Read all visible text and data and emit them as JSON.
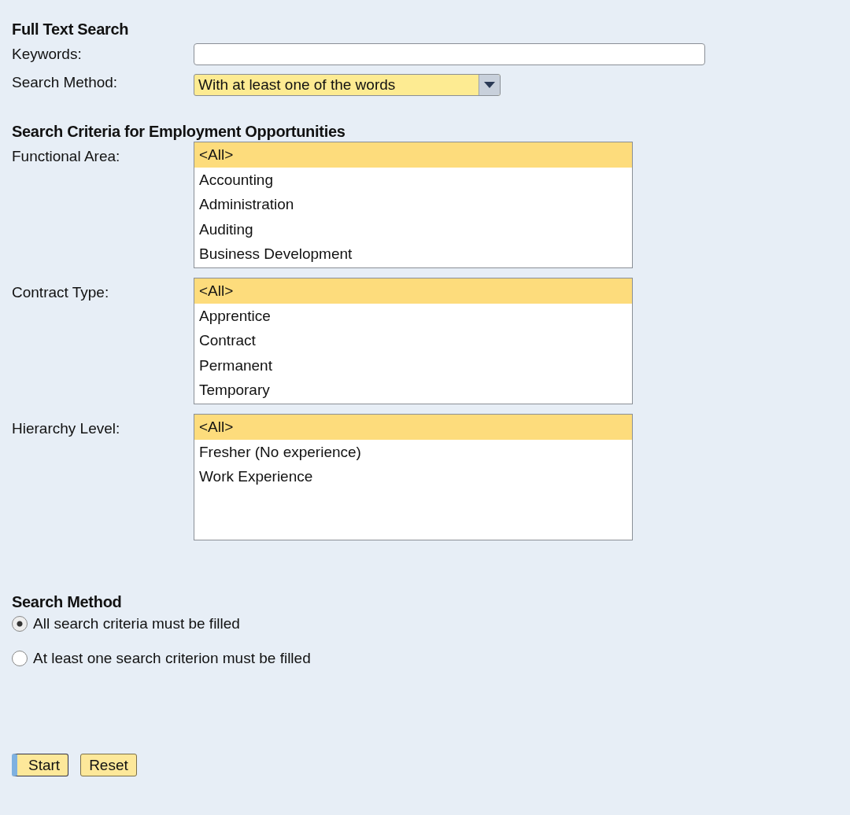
{
  "full_text_search": {
    "title": "Full Text Search",
    "keywords": {
      "label": "Keywords:"
    },
    "search_method": {
      "label": "Search Method:",
      "value": "With at least one of the words"
    }
  },
  "criteria": {
    "title": "Search Criteria for Employment Opportunities",
    "lists": [
      {
        "label": "Functional Area:",
        "items": [
          {
            "text": "<All>",
            "selected": true
          },
          {
            "text": "Accounting",
            "selected": false
          },
          {
            "text": "Administration",
            "selected": false
          },
          {
            "text": "Auditing",
            "selected": false
          },
          {
            "text": "Business Development",
            "selected": false
          }
        ]
      },
      {
        "label": "Contract Type:",
        "items": [
          {
            "text": "<All>",
            "selected": true
          },
          {
            "text": "Apprentice",
            "selected": false
          },
          {
            "text": "Contract",
            "selected": false
          },
          {
            "text": "Permanent",
            "selected": false
          },
          {
            "text": "Temporary",
            "selected": false
          }
        ]
      },
      {
        "label": "Hierarchy Level:",
        "items": [
          {
            "text": "<All>",
            "selected": true
          },
          {
            "text": "Fresher (No experience)",
            "selected": false
          },
          {
            "text": "Work Experience",
            "selected": false
          }
        ]
      }
    ]
  },
  "search_method": {
    "title": "Search Method",
    "options": [
      {
        "label": "All search criteria must be filled",
        "selected": true
      },
      {
        "label": "At least one search criterion must be filled",
        "selected": false
      }
    ]
  },
  "buttons": [
    {
      "label": "Start",
      "focused": true
    },
    {
      "label": "Reset",
      "focused": false
    }
  ]
}
